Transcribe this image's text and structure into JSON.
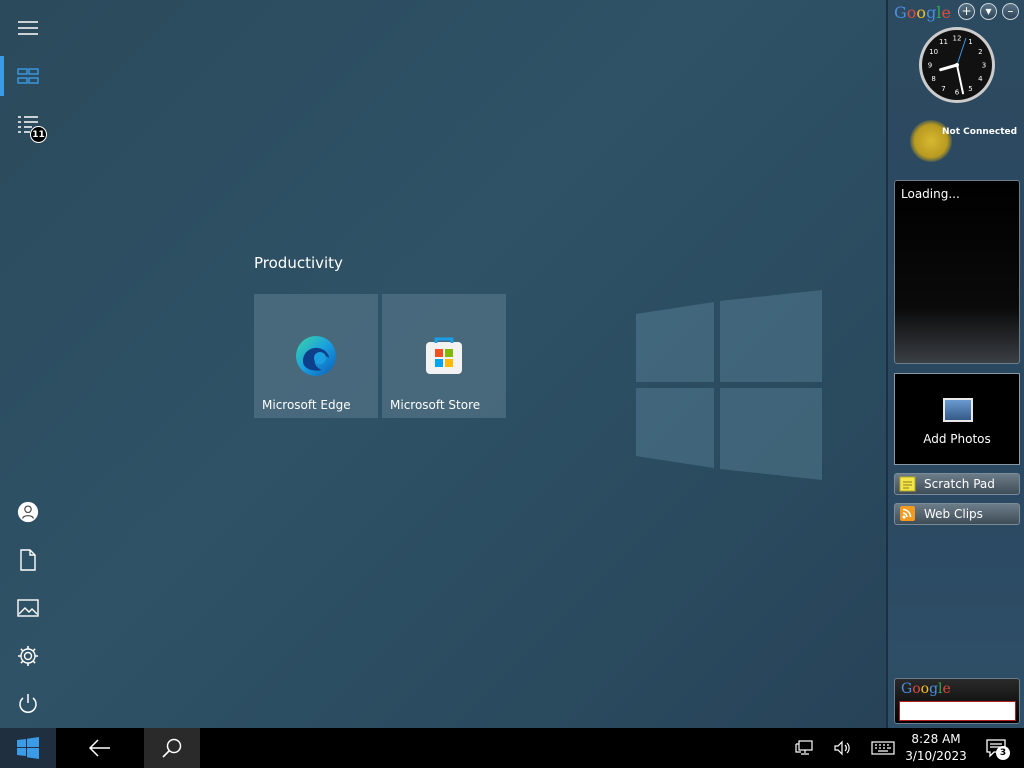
{
  "rail": {
    "badge_count": "11"
  },
  "tiles": {
    "group_title": "Productivity",
    "items": [
      {
        "label": "Microsoft Edge",
        "icon": "edge-icon"
      },
      {
        "label": "Microsoft Store",
        "icon": "store-icon"
      }
    ]
  },
  "sidebar": {
    "logo": "Google",
    "controls": [
      "+",
      "▾",
      "–"
    ],
    "clock": {
      "hour": 8,
      "minute": 28
    },
    "weather_status": "Not Connected",
    "news_status": "Loading...",
    "photos_label": "Add Photos",
    "gadgets": [
      {
        "label": "Scratch Pad",
        "icon": "note-icon"
      },
      {
        "label": "Web Clips",
        "icon": "rss-icon"
      }
    ],
    "search_logo": "Google",
    "search_value": ""
  },
  "taskbar": {
    "time": "8:28 AM",
    "date": "3/10/2023",
    "notification_count": "3"
  },
  "colors": {
    "accent": "#3a9be6",
    "google_blue": "#4a8fe0",
    "google_red": "#e04a3a",
    "google_yellow": "#f2c026",
    "google_green": "#35a853"
  }
}
